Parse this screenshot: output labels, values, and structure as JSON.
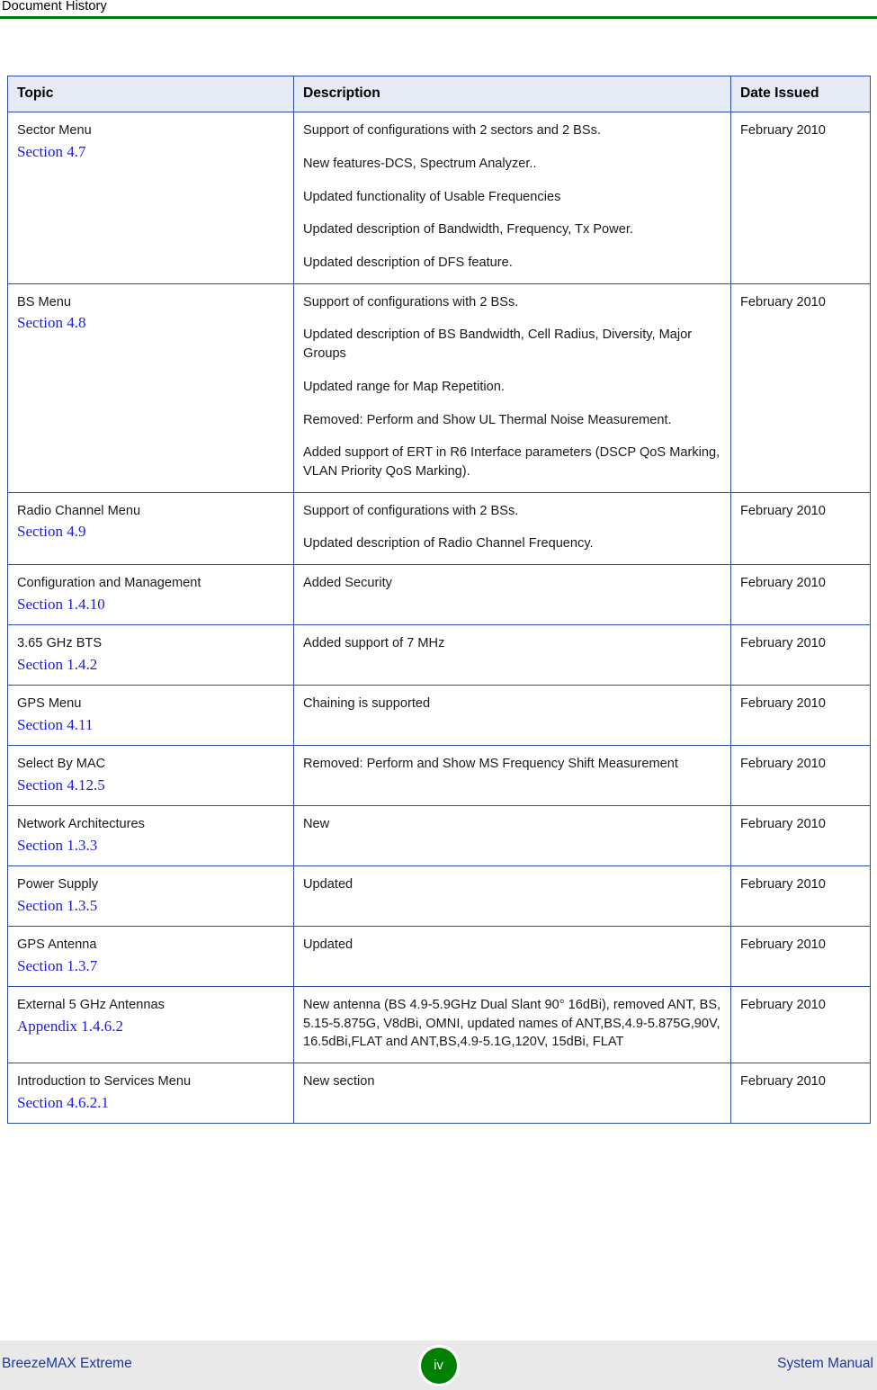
{
  "header": {
    "running_head": "Document History",
    "rule_color": "#007a00"
  },
  "table": {
    "columns": [
      "Topic",
      "Description",
      "Date Issued"
    ],
    "header_bg": "#e6eaf5",
    "border_color": "#2b4f9e",
    "link_color": "#1b1bdd",
    "rows": [
      {
        "topic": "Sector Menu",
        "link": "Section 4.7",
        "description": [
          "Support of configurations with 2 sectors and 2 BSs.",
          "New features-DCS, Spectrum Analyzer..",
          "Updated functionality of Usable Frequencies",
          "Updated description of Bandwidth, Frequency, Tx Power.",
          "Updated description of DFS feature."
        ],
        "date": "February 2010"
      },
      {
        "topic": "BS Menu",
        "link": "Section 4.8",
        "description": [
          "Support of configurations with 2 BSs.",
          "Updated description of BS Bandwidth, Cell Radius, Diversity, Major Groups",
          "Updated range for Map Repetition.",
          "Removed: Perform and Show UL Thermal Noise Measurement.",
          "Added support of ERT in R6 Interface parameters (DSCP QoS Marking, VLAN Priority QoS Marking)."
        ],
        "date": "February 2010"
      },
      {
        "topic": "Radio Channel Menu",
        "link": "Section 4.9",
        "description": [
          "Support of configurations with 2 BSs.",
          "Updated description of Radio Channel Frequency."
        ],
        "date": "February 2010"
      },
      {
        "topic": "Configuration and Management",
        "link": "Section 1.4.10",
        "description": [
          "Added Security"
        ],
        "date": "February 2010"
      },
      {
        "topic": "3.65 GHz BTS",
        "link": "Section 1.4.2",
        "description": [
          "Added support of 7 MHz"
        ],
        "date": "February 2010"
      },
      {
        "topic": "GPS Menu",
        "link": "Section 4.11",
        "description": [
          "Chaining is supported"
        ],
        "date": "February 2010"
      },
      {
        "topic": "Select By MAC",
        "link": "Section 4.12.5",
        "description": [
          "Removed: Perform and Show MS Frequency Shift Measurement"
        ],
        "date": "February 2010"
      },
      {
        "topic": "Network Architectures",
        "link": "Section 1.3.3",
        "description": [
          "New"
        ],
        "date": "February 2010"
      },
      {
        "topic": "Power Supply",
        "link": "Section 1.3.5",
        "description": [
          "Updated"
        ],
        "date": "February 2010"
      },
      {
        "topic": "GPS Antenna",
        "link": "Section 1.3.7",
        "description": [
          "Updated"
        ],
        "date": "February 2010"
      },
      {
        "topic": "External 5 GHz Antennas",
        "link": "Appendix 1.4.6.2",
        "description": [
          "New antenna (BS 4.9-5.9GHz Dual Slant 90° 16dBi), removed ANT, BS, 5.15-5.875G, V8dBi, OMNI, updated names of ANT,BS,4.9-5.875G,90V, 16.5dBi,FLAT and ANT,BS,4.9-5.1G,120V, 15dBi, FLAT"
        ],
        "date": "February 2010"
      },
      {
        "topic": "Introduction to Services Menu",
        "link": "Section 4.6.2.1",
        "description": [
          "New section"
        ],
        "date": "February 2010"
      }
    ]
  },
  "footer": {
    "left": "BreezeMAX Extreme",
    "page_number": "iv",
    "right": "System Manual",
    "badge_color": "#008000",
    "text_color": "#1b3b9b",
    "band_color": "#e9e9e9"
  }
}
